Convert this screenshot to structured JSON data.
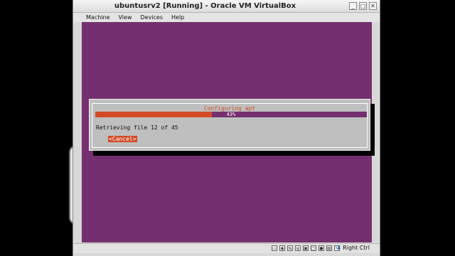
{
  "window": {
    "title": "ubuntusrv2 [Running] - Oracle VM VirtualBox",
    "controls": [
      "_",
      "□",
      "✕"
    ]
  },
  "menubar": {
    "items": [
      "Machine",
      "View",
      "Devices",
      "Help"
    ]
  },
  "dialog": {
    "title": "Configuring apt",
    "progress_percent": 43,
    "progress_label": "43%",
    "status": "Retrieving file 12 of 45",
    "cancel_label": "<Cancel>"
  },
  "colors": {
    "vm_background": "#74306e",
    "accent": "#d24a26",
    "dialog_background": "#bfbfbf"
  },
  "statusbar": {
    "icons": [
      "hard-disk-icon",
      "optical-drive-icon",
      "network-icon",
      "usb-icon",
      "shared-folder-icon",
      "display-icon",
      "video-capture-icon",
      "cpu-icon",
      "mouse-integration-icon"
    ],
    "host_key": "Right Ctrl"
  }
}
